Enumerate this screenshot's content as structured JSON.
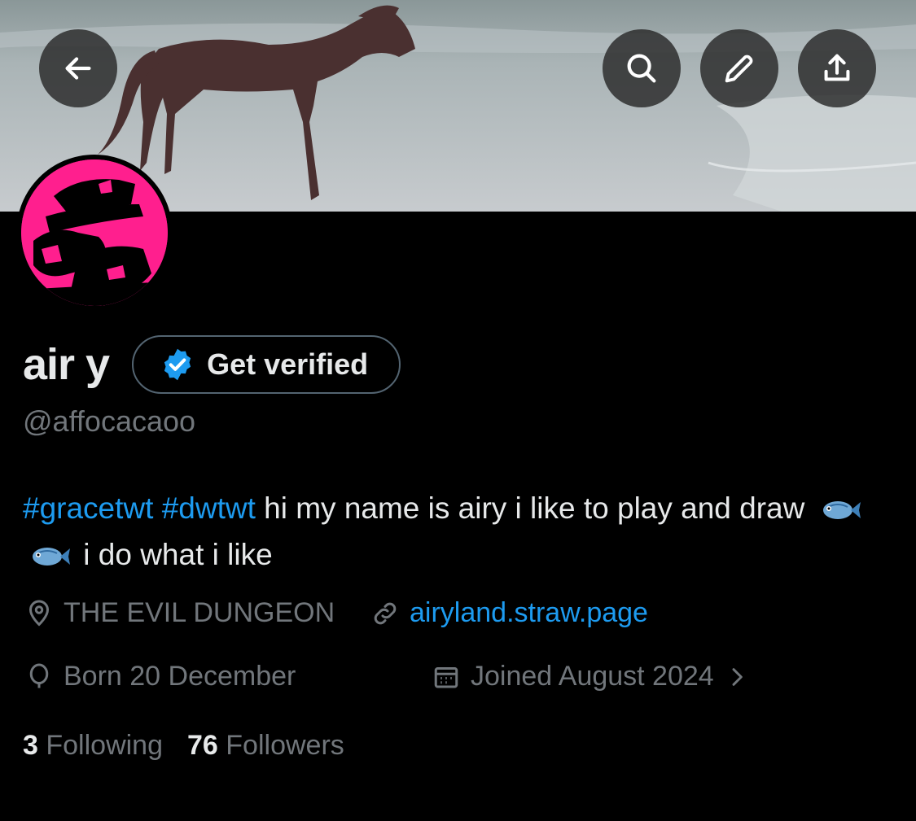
{
  "header": {
    "back_icon": "arrow-left-icon",
    "search_icon": "search-icon",
    "edit_icon": "pencil-icon",
    "share_icon": "share-icon"
  },
  "profile": {
    "display_name": "air y",
    "verify_label": "Get verified",
    "handle": "@affocacaoo",
    "bio": {
      "tag1": "#gracetwt",
      "tag2": "#dwtwt",
      "text1": " hi my name is airy i like to play and draw ",
      "text2": " i do what i like"
    },
    "location": "THE EVIL DUNGEON",
    "website": "airyland.straw.page",
    "birthday": "Born 20 December",
    "joined": "Joined August 2024",
    "following_count": "3",
    "following_label": "Following",
    "followers_count": "76",
    "followers_label": "Followers"
  },
  "colors": {
    "accent": "#1d9bf0",
    "secondary_text": "#71767b",
    "avatar_bg": "#ff1f8e"
  }
}
